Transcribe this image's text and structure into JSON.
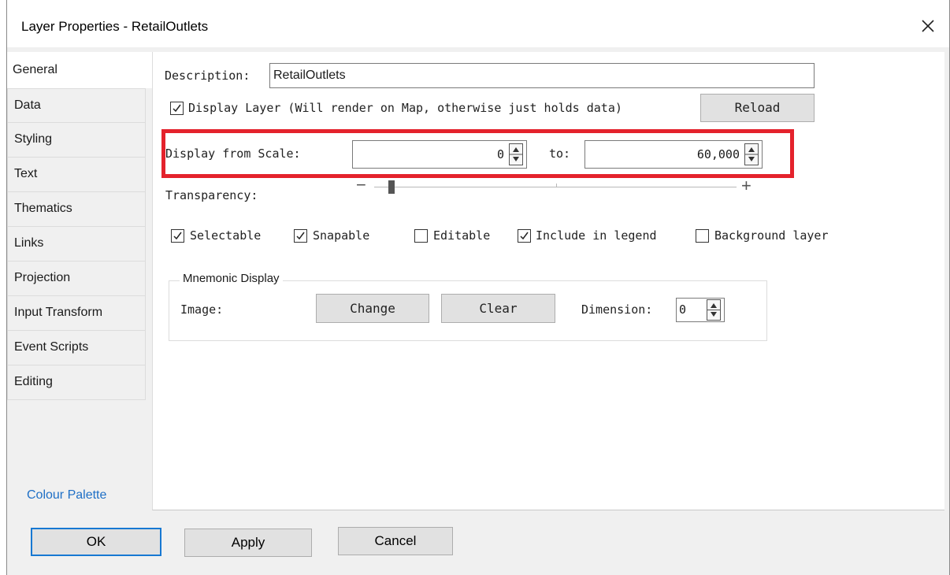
{
  "window": {
    "title": "Layer Properties - RetailOutlets"
  },
  "tabs": [
    {
      "label": "General",
      "active": true
    },
    {
      "label": "Data"
    },
    {
      "label": "Styling"
    },
    {
      "label": "Text"
    },
    {
      "label": "Thematics"
    },
    {
      "label": "Links"
    },
    {
      "label": "Projection"
    },
    {
      "label": "Input Transform"
    },
    {
      "label": "Event Scripts"
    },
    {
      "label": "Editing"
    }
  ],
  "colour_palette_link": "Colour Palette",
  "general": {
    "description_label": "Description:",
    "description_value": "RetailOutlets",
    "display_layer_label": "Display Layer (Will render on Map, otherwise just holds data)",
    "display_layer_checked": true,
    "reload_label": "Reload",
    "display_from_scale_label": "Display from Scale:",
    "scale_from_value": "0",
    "scale_to_label": "to:",
    "scale_to_value": "60,000",
    "transparency_label": "Transparency:",
    "transparency_minus": "−",
    "transparency_plus": "+",
    "transparency_level": 0.04,
    "options": [
      {
        "label": "Selectable",
        "checked": true
      },
      {
        "label": "Snapable",
        "checked": true
      },
      {
        "label": "Editable",
        "checked": false
      },
      {
        "label": "Include in legend",
        "checked": true
      },
      {
        "label": "Background layer",
        "checked": false
      }
    ]
  },
  "mnemonic": {
    "group_label": "Mnemonic Display",
    "image_label": "Image:",
    "change_label": "Change",
    "clear_label": "Clear",
    "dimension_label": "Dimension:",
    "dimension_value": "0"
  },
  "footer": {
    "ok_label": "OK",
    "apply_label": "Apply",
    "cancel_label": "Cancel"
  },
  "colors": {
    "highlight": "#e4222c",
    "link": "#1e6fc6",
    "default_button_border": "#1778d2"
  }
}
